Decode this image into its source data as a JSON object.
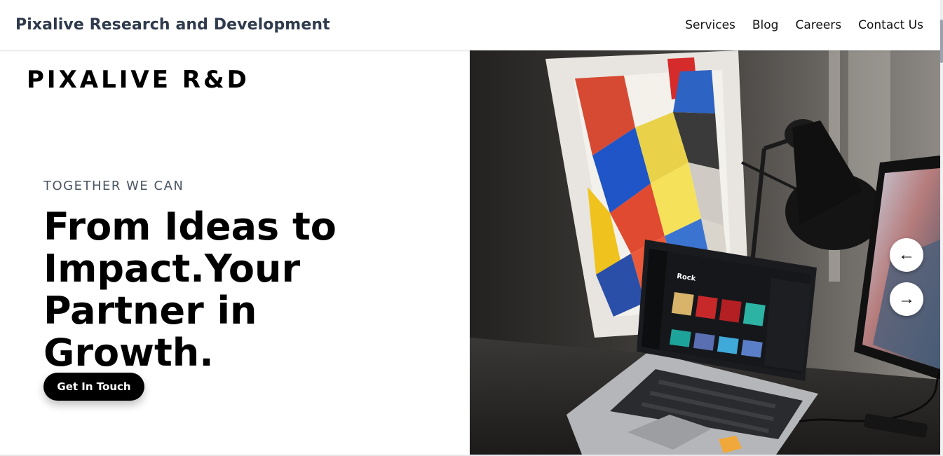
{
  "header": {
    "brand": "Pixalive Research and Development",
    "nav": [
      {
        "label": "Services"
      },
      {
        "label": "Blog"
      },
      {
        "label": "Careers"
      },
      {
        "label": "Contact Us"
      }
    ]
  },
  "hero": {
    "logo_text": "PIXALIVE R&D",
    "eyebrow": "TOGETHER WE CAN",
    "headline": "From Ideas to Impact.Your Partner in Growth.",
    "cta_label": "Get In Touch"
  },
  "carousel": {
    "prev_icon": "arrow-left-icon",
    "next_icon": "arrow-right-icon",
    "prev_glyph": "←",
    "next_glyph": "→",
    "laptop_screen_title": "Rock"
  },
  "colors": {
    "brand_text": "#2f3b4c",
    "cta_bg": "#000000",
    "eyebrow_text": "#4b5563"
  }
}
